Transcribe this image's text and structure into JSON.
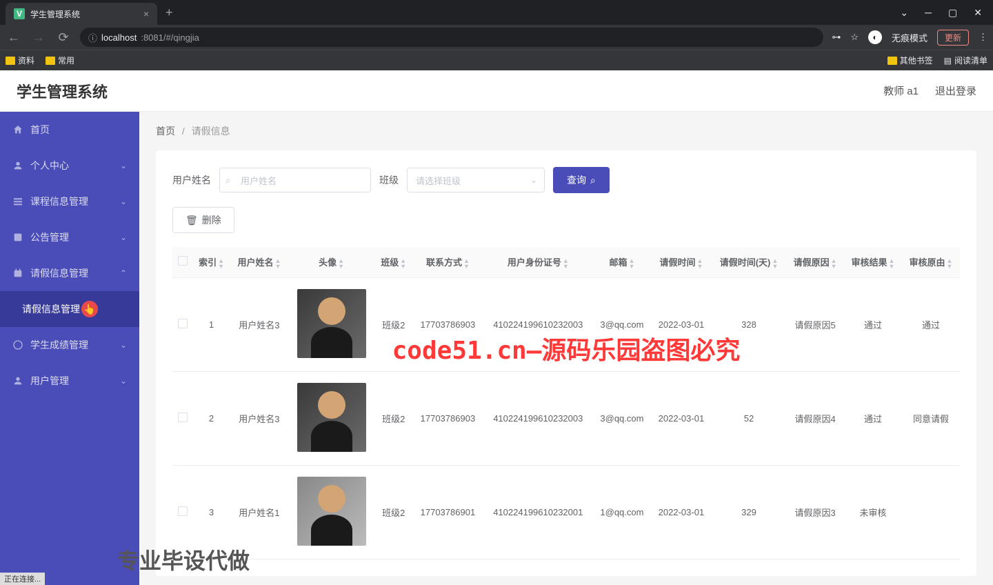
{
  "browser": {
    "tab_title": "学生管理系统",
    "url_host": "localhost",
    "url_path": ":8081/#/qingjia",
    "incognito_label": "无痕模式",
    "update_label": "更新",
    "bookmarks": {
      "folder1": "资料",
      "folder2": "常用",
      "other": "其他书签",
      "reading": "阅读清单"
    },
    "status": "正在连接..."
  },
  "header": {
    "app_title": "学生管理系统",
    "user_label": "教师 a1",
    "logout_label": "退出登录"
  },
  "sidebar": {
    "items": [
      {
        "label": "首页",
        "icon": "home"
      },
      {
        "label": "个人中心",
        "icon": "user",
        "chevron": "down"
      },
      {
        "label": "课程信息管理",
        "icon": "list",
        "chevron": "down"
      },
      {
        "label": "公告管理",
        "icon": "notice",
        "chevron": "down"
      },
      {
        "label": "请假信息管理",
        "icon": "leave",
        "chevron": "up"
      },
      {
        "label": "请假信息管理",
        "active": true
      },
      {
        "label": "学生成绩管理",
        "icon": "grade",
        "chevron": "down"
      },
      {
        "label": "用户管理",
        "icon": "user",
        "chevron": "down"
      }
    ]
  },
  "breadcrumb": {
    "home": "首页",
    "current": "请假信息"
  },
  "search": {
    "username_label": "用户姓名",
    "username_placeholder": "用户姓名",
    "class_label": "班级",
    "class_placeholder": "请选择班级",
    "query_btn": "查询",
    "delete_btn": "删除"
  },
  "table": {
    "headers": {
      "index": "索引",
      "username": "用户姓名",
      "avatar": "头像",
      "class": "班级",
      "contact": "联系方式",
      "idcard": "用户身份证号",
      "email": "邮箱",
      "leave_date": "请假时间",
      "leave_days": "请假时间(天)",
      "reason": "请假原因",
      "result": "审核结果",
      "reply": "审核原由"
    },
    "rows": [
      {
        "idx": "1",
        "username": "用户姓名3",
        "class": "班级2",
        "contact": "17703786903",
        "idcard": "410224199610232003",
        "email": "3@qq.com",
        "leave_date": "2022-03-01",
        "days": "328",
        "reason": "请假原因5",
        "result": "通过",
        "reply": "通过"
      },
      {
        "idx": "2",
        "username": "用户姓名3",
        "class": "班级2",
        "contact": "17703786903",
        "idcard": "410224199610232003",
        "email": "3@qq.com",
        "leave_date": "2022-03-01",
        "days": "52",
        "reason": "请假原因4",
        "result": "通过",
        "reply": "同意请假"
      },
      {
        "idx": "3",
        "username": "用户姓名1",
        "class": "班级2",
        "contact": "17703786901",
        "idcard": "410224199610232001",
        "email": "1@qq.com",
        "leave_date": "2022-03-01",
        "days": "329",
        "reason": "请假原因3",
        "result": "未审核",
        "reply": ""
      }
    ]
  },
  "watermarks": {
    "center": "code51.cn—源码乐园盗图必究",
    "bottom": "专业毕设代做"
  }
}
